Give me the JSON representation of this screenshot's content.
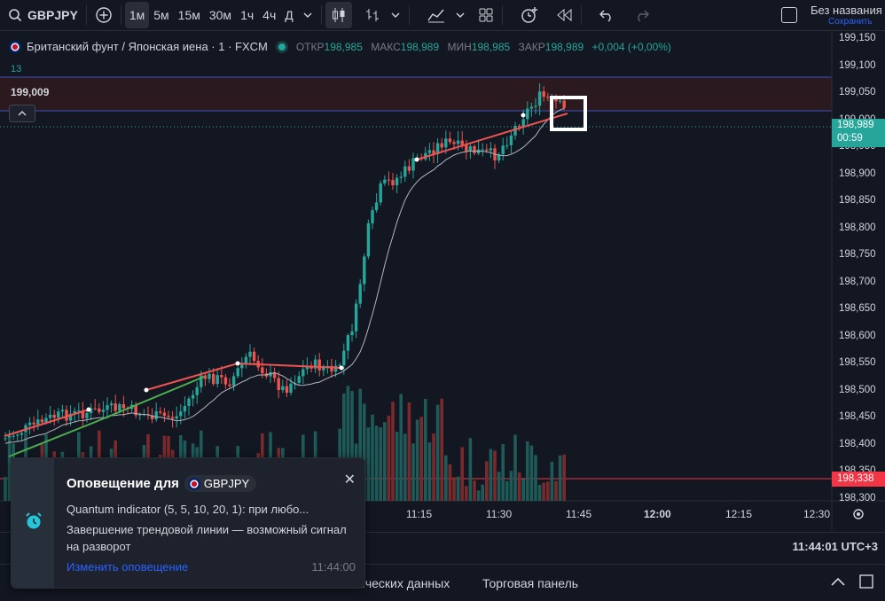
{
  "toolbar": {
    "symbol": "GBPJPY",
    "timeframes": [
      "1м",
      "5м",
      "15м",
      "30м",
      "1ч",
      "4ч",
      "Д"
    ],
    "active_timeframe": "1м",
    "layout_name": "Без названия",
    "save_label": "Сохранить"
  },
  "legend": {
    "title": "Британский фунт / Японская иена · 1 · FXCM",
    "open_label": "ОТКР",
    "open": "198,985",
    "high_label": "МАКС",
    "high": "198,989",
    "low_label": "МИН",
    "low": "198,985",
    "close_label": "ЗАКР",
    "close": "198,989",
    "change": "+0,004 (+0,00%)",
    "sub_value": "13",
    "line_label": "199,009"
  },
  "price_scale": {
    "labels": [
      "199,150",
      "199,100",
      "199,050",
      "199,000",
      "198,950",
      "198,900",
      "198,850",
      "198,800",
      "198,750",
      "198,700",
      "198,650",
      "198,600",
      "198,550",
      "198,500",
      "198,450",
      "198,400",
      "198,350",
      "198,300"
    ],
    "current_price": "198,989",
    "countdown": "00:59",
    "alert_price": "198,338"
  },
  "time_axis": {
    "labels": [
      "11:15",
      "11:30",
      "11:45",
      "12:00",
      "12:15",
      "12:30"
    ]
  },
  "status": {
    "clock": "11:44:01 UTC+3"
  },
  "bottom_tabs": {
    "tab1": "ических данных",
    "tab2": "Торговая панель"
  },
  "notification": {
    "title": "Оповещение для",
    "symbol": "GBPJPY",
    "line1": "Quantum indicator (5, 5, 10, 20, 1): при любо...",
    "line2": "Завершение трендовой линии — возможный сигнал на разворот",
    "link": "Изменить оповещение",
    "time": "11:44:00"
  },
  "colors": {
    "up": "#26a69a",
    "down": "#ef5350",
    "accent": "#2962ff",
    "bg": "#131722"
  }
}
